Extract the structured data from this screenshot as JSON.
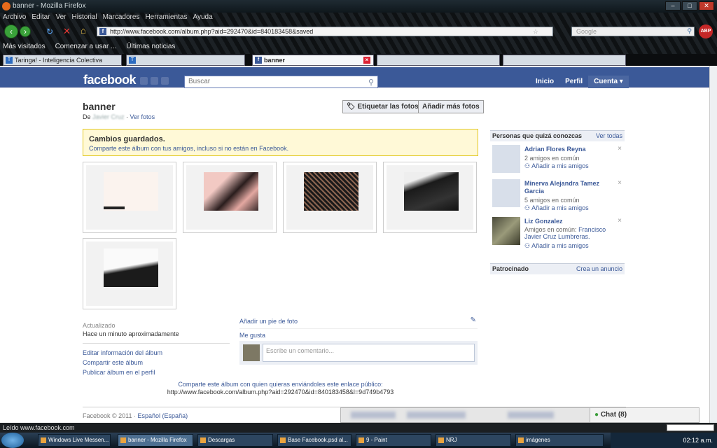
{
  "window": {
    "title": "banner - Mozilla Firefox"
  },
  "menu": [
    "Archivo",
    "Editar",
    "Ver",
    "Historial",
    "Marcadores",
    "Herramientas",
    "Ayuda"
  ],
  "url": "http://www.facebook.com/album.php?aid=292470&id=840183458&saved",
  "search_placeholder": "Google",
  "bookmarks": [
    "Más visitados",
    "Comenzar a usar ...",
    "Últimas noticias"
  ],
  "tabs": [
    {
      "label": "Taringa! - Inteligencia Colectiva",
      "active": false
    },
    {
      "label": "banner",
      "active": true
    }
  ],
  "fb": {
    "logo": "facebook",
    "search_placeholder": "Buscar",
    "nav": [
      "Inicio",
      "Perfil",
      "Cuenta ▾"
    ],
    "album_title": "banner",
    "by_prefix": "De",
    "owner": "Javier Cruz",
    "view_photos": "Ver fotos",
    "tag_button": "Etiquetar las fotos",
    "add_button": "Añadir más fotos",
    "notice_title": "Cambios guardados.",
    "notice_text": "Comparte este álbum con tus amigos, incluso si no están en Facebook.",
    "updated_label": "Actualizado",
    "updated_value": "Hace un minuto aproximadamente",
    "album_links": [
      "Editar información del álbum",
      "Compartir este álbum",
      "Publicar álbum en el perfil"
    ],
    "caption_link": "Añadir un pie de foto",
    "like": "Me gusta",
    "comment_placeholder": "Escribe un comentario...",
    "share_text": "Comparte este álbum con quien quieras enviándoles este enlace público:",
    "share_url": "http://www.facebook.com/album.php?aid=292470&id=840183458&l=9d749b4793",
    "footer_copy": "Facebook © 2011 ·",
    "footer_lang": "Español (España)",
    "chat": "Chat (8)"
  },
  "sidebar": {
    "people_header": "Personas que quizá conozcas",
    "see_all": "Ver todas",
    "people": [
      {
        "name": "Adrian Flores Reyna",
        "mutual": "2 amigos en común",
        "add": "Añadir a mis amigos"
      },
      {
        "name": "Minerva Alejandra Tamez Garcia",
        "mutual": "5 amigos en común",
        "add": "Añadir a mis amigos"
      },
      {
        "name": "Liz Gonzalez",
        "mutual_prefix": "Amigos en común:",
        "mutual_name": "Francisco Javier Cruz Lumbreras.",
        "add": "Añadir a mis amigos"
      }
    ],
    "sponsored_header": "Patrocinado",
    "create_ad": "Crea un anuncio"
  },
  "status": "Leído www.facebook.com",
  "taskbar": [
    "Windows Live Messen...",
    "banner - Mozilla Firefox",
    "Descargas",
    "Base Facebook.psd al...",
    "9 - Paint",
    "NRJ",
    "imágenes"
  ],
  "clock": "02:12 a.m."
}
